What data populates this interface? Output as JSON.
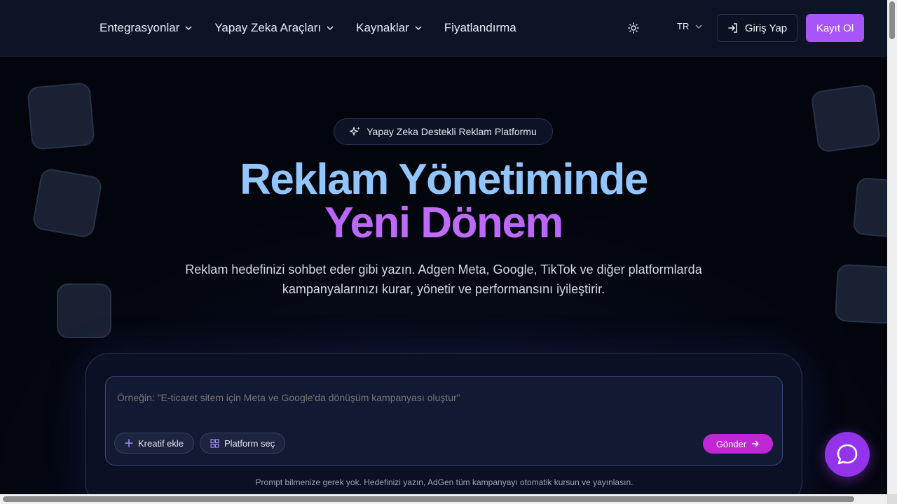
{
  "nav": {
    "items": [
      {
        "label": "Entegrasyonlar",
        "has_dropdown": true
      },
      {
        "label": "Yapay Zeka Araçları",
        "has_dropdown": true
      },
      {
        "label": "Kaynaklar",
        "has_dropdown": true
      },
      {
        "label": "Fiyatlandırma",
        "has_dropdown": false
      }
    ],
    "language": "TR",
    "login_label": "Giriş Yap",
    "signup_label": "Kayıt Ol",
    "theme_icon": "sun-icon"
  },
  "hero": {
    "badge": "Yapay Zeka Destekli Reklam Platformu",
    "title_line1": "Reklam Yönetiminde",
    "title_line2": "Yeni Dönem",
    "subtitle": "Reklam hedefinizi sohbet eder gibi yazın. Adgen Meta, Google, TikTok ve diğer platformlarda kampanyalarınızı kurar, yönetir ve performansını iyileştirir."
  },
  "prompt": {
    "placeholder": "Örneğin: \"E-ticaret sitem için Meta ve Google'da dönüşüm kampanyası oluştur\"",
    "add_creative_label": "Kreatif ekle",
    "select_platform_label": "Platform seç",
    "send_label": "Gönder",
    "hint": "Prompt bilmenize gerek yok. Hedefinizi yazın, AdGen tüm kampanyayı otomatik kursun ve yayınlasın."
  },
  "colors": {
    "accent": "#a855f7",
    "send": "#c026d3",
    "title_blue": "#93c5fd"
  }
}
